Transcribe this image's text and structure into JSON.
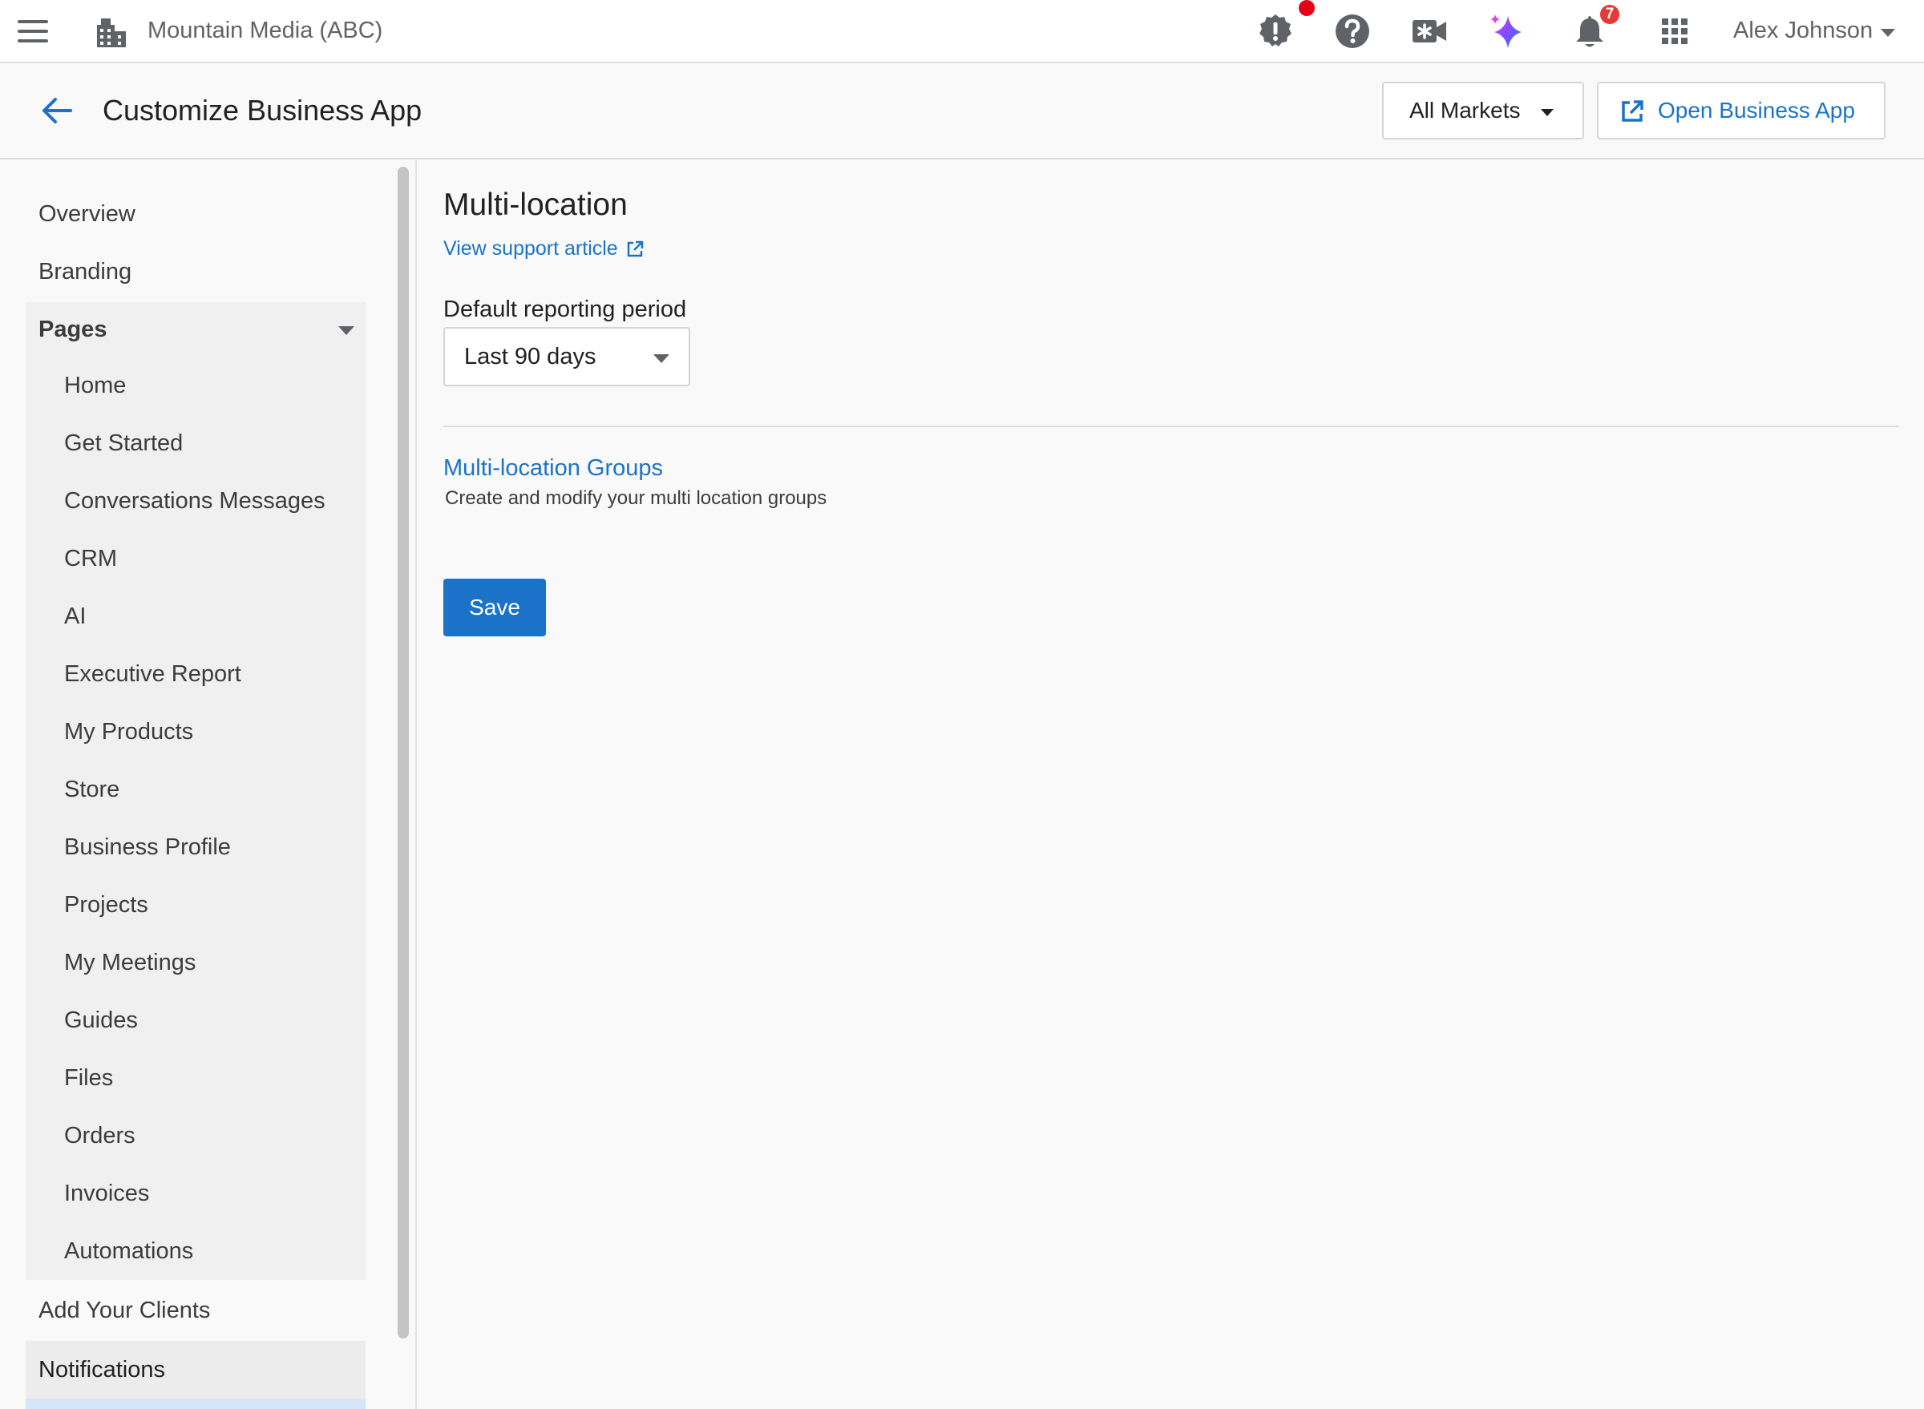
{
  "topbar": {
    "org_name": "Mountain Media (ABC)",
    "notifications_count": "7",
    "user_name": "Alex Johnson",
    "icons": [
      "menu-icon",
      "building-icon",
      "alert-icon",
      "help-icon",
      "video-icon",
      "ai-sparkle-icon",
      "bell-icon",
      "apps-grid-icon"
    ]
  },
  "header": {
    "title": "Customize Business App",
    "markets_label": "All Markets",
    "open_app_label": "Open Business App"
  },
  "sidebar": {
    "items": [
      {
        "label": "Overview"
      },
      {
        "label": "Branding"
      },
      {
        "label": "Pages"
      },
      {
        "label": "Home"
      },
      {
        "label": "Get Started"
      },
      {
        "label": "Conversations Messages"
      },
      {
        "label": "CRM"
      },
      {
        "label": "AI"
      },
      {
        "label": "Executive Report"
      },
      {
        "label": "My Products"
      },
      {
        "label": "Store"
      },
      {
        "label": "Business Profile"
      },
      {
        "label": "Projects"
      },
      {
        "label": "My Meetings"
      },
      {
        "label": "Guides"
      },
      {
        "label": "Files"
      },
      {
        "label": "Orders"
      },
      {
        "label": "Invoices"
      },
      {
        "label": "Automations"
      },
      {
        "label": "Add Your Clients"
      },
      {
        "label": "Notifications"
      }
    ]
  },
  "main": {
    "section_title": "Multi-location",
    "support_link": "View support article",
    "reporting_label": "Default reporting period",
    "reporting_value": "Last 90 days",
    "groups_link": "Multi-location Groups",
    "groups_desc": "Create and modify your multi location groups",
    "save_label": "Save"
  },
  "colors": {
    "accent": "#1a73c9",
    "alert_badge": "#e5001a",
    "notification_badge": "#e53935"
  }
}
